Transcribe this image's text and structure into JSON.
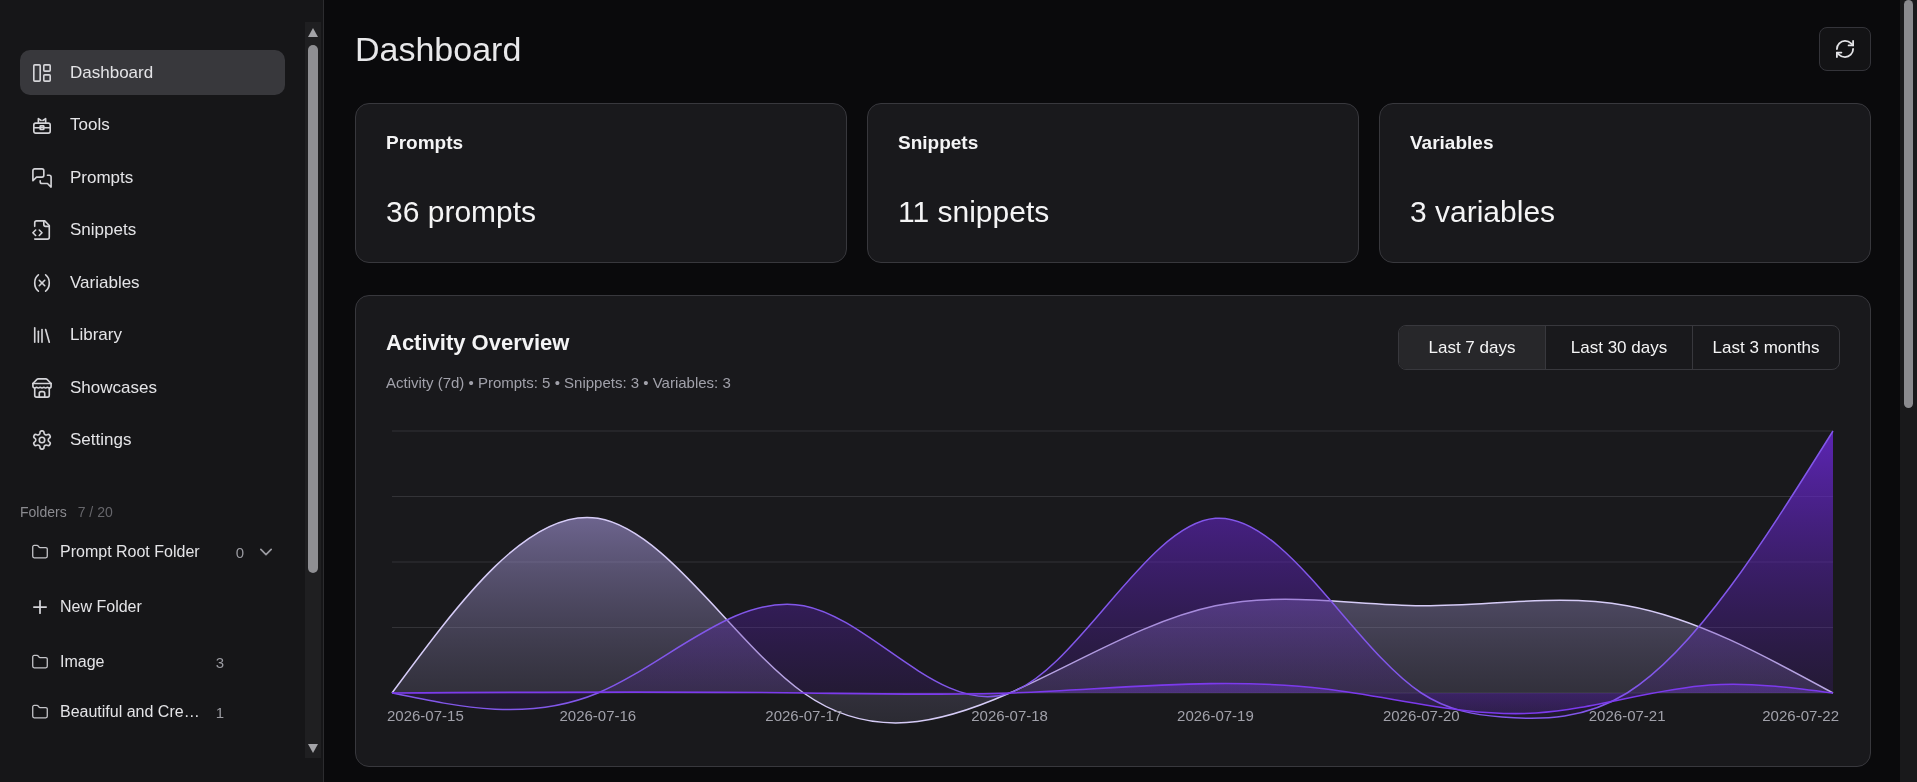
{
  "sidebar": {
    "nav_items": [
      {
        "label": "Dashboard",
        "selected": true
      },
      {
        "label": "Tools",
        "selected": false
      },
      {
        "label": "Prompts",
        "selected": false
      },
      {
        "label": "Snippets",
        "selected": false
      },
      {
        "label": "Variables",
        "selected": false
      },
      {
        "label": "Library",
        "selected": false
      },
      {
        "label": "Showcases",
        "selected": false
      },
      {
        "label": "Settings",
        "selected": false
      }
    ],
    "folders": {
      "label": "Folders",
      "count": "7 / 20",
      "root": {
        "name": "Prompt Root Folder",
        "count": "0",
        "expanded": true
      },
      "new_folder": "New Folder",
      "items": [
        {
          "name": "Image",
          "count": "3"
        },
        {
          "name": "Beautiful and Cre…",
          "count": "1"
        }
      ]
    }
  },
  "header": {
    "title": "Dashboard"
  },
  "stats": [
    {
      "label": "Prompts",
      "value": "36 prompts"
    },
    {
      "label": "Snippets",
      "value": "11 snippets"
    },
    {
      "label": "Variables",
      "value": "3 variables"
    }
  ],
  "activity": {
    "title": "Activity Overview",
    "summary": "Activity (7d) • Prompts: 5 • Snippets: 3 • Variables: 3",
    "ranges": [
      {
        "label": "Last 7 days",
        "selected": true
      },
      {
        "label": "Last 30 days",
        "selected": false
      },
      {
        "label": "Last 3 months",
        "selected": false
      }
    ],
    "x_labels": [
      "2026-07-15",
      "2026-07-16",
      "2026-07-17",
      "2026-07-18",
      "2026-07-19",
      "2026-07-20",
      "2026-07-21",
      "2026-07-22"
    ]
  }
}
